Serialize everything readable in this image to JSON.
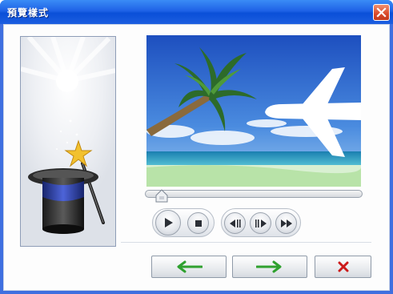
{
  "window": {
    "title": "預覽樣式"
  },
  "colors": {
    "titlebar": "#0a4fd8",
    "close_button": "#d9482a",
    "back_arrow": "#2fa12f",
    "next_arrow": "#2fa12f",
    "cancel_x": "#cc1a1a"
  },
  "icons": {
    "close": "close-icon",
    "magic": "magic-hat-icon",
    "play": "play-icon",
    "stop": "stop-icon",
    "frame_back": "frame-back-icon",
    "frame_forward": "frame-forward-icon",
    "fast_forward": "fast-forward-icon",
    "back": "left-arrow-icon",
    "next": "right-arrow-icon",
    "cancel": "cancel-x-icon"
  },
  "player": {
    "seek_position": 0.05
  }
}
